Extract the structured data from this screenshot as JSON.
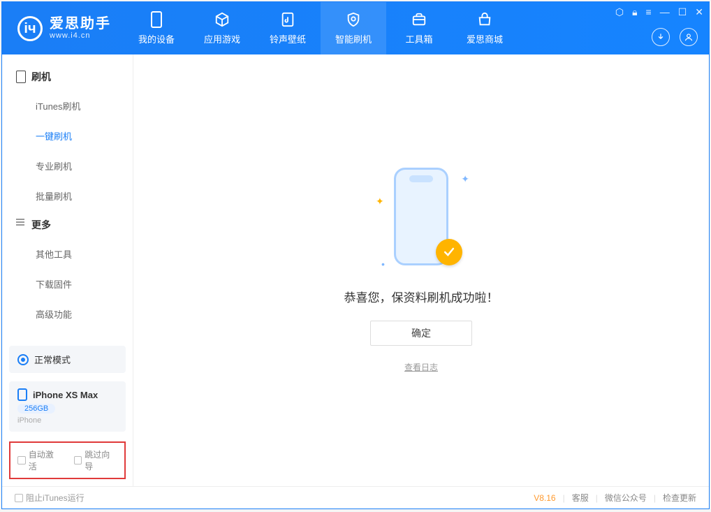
{
  "app": {
    "name_cn": "爱思助手",
    "name_en": "www.i4.cn"
  },
  "tabs": [
    {
      "key": "device",
      "label": "我的设备"
    },
    {
      "key": "apps",
      "label": "应用游戏"
    },
    {
      "key": "ring",
      "label": "铃声壁纸"
    },
    {
      "key": "flash",
      "label": "智能刷机",
      "active": true
    },
    {
      "key": "tools",
      "label": "工具箱"
    },
    {
      "key": "store",
      "label": "爱思商城"
    }
  ],
  "sidebar": {
    "section1": {
      "title": "刷机"
    },
    "items1": [
      {
        "label": "iTunes刷机"
      },
      {
        "label": "一键刷机",
        "active": true
      },
      {
        "label": "专业刷机"
      },
      {
        "label": "批量刷机"
      }
    ],
    "section2": {
      "title": "更多"
    },
    "items2": [
      {
        "label": "其他工具"
      },
      {
        "label": "下载固件"
      },
      {
        "label": "高级功能"
      }
    ],
    "mode": {
      "label": "正常模式"
    },
    "device": {
      "name": "iPhone XS Max",
      "storage": "256GB",
      "type": "iPhone"
    },
    "checkboxes": {
      "auto_activate": "自动激活",
      "skip_guide": "跳过向导"
    }
  },
  "main": {
    "success_text": "恭喜您，保资料刷机成功啦！",
    "ok_btn": "确定",
    "log_link": "查看日志"
  },
  "footer": {
    "stop_itunes": "阻止iTunes运行",
    "version": "V8.16",
    "links": {
      "service": "客服",
      "wechat": "微信公众号",
      "update": "检查更新"
    }
  }
}
